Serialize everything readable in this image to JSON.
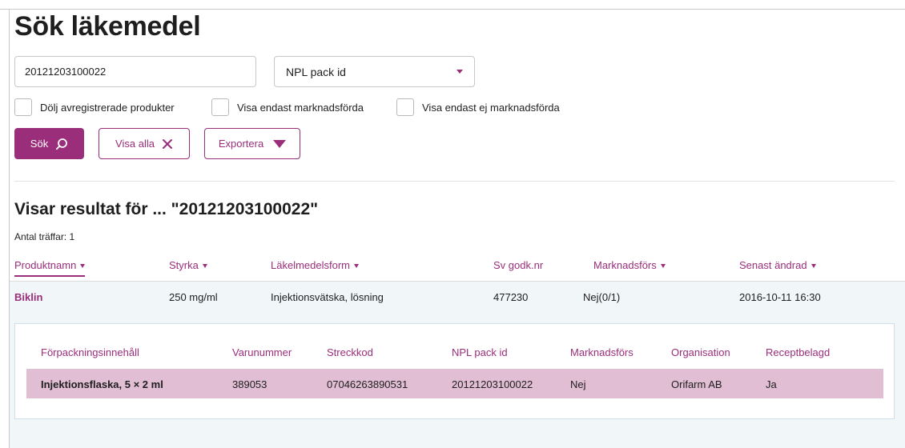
{
  "page": {
    "title": "Sök läkemedel"
  },
  "search": {
    "value": "20121203100022",
    "placeholder": "",
    "type_selected": "NPL pack id"
  },
  "filters": [
    {
      "label": "Dölj avregistrerade produkter",
      "checked": false
    },
    {
      "label": "Visa endast marknadsförda",
      "checked": false
    },
    {
      "label": "Visa endast ej marknadsförda",
      "checked": false
    }
  ],
  "buttons": {
    "search": "Sök",
    "show_all": "Visa alla",
    "export": "Exportera"
  },
  "results": {
    "heading": "Visar resultat för ... \"20121203100022\"",
    "count_label": "Antal träffar: 1",
    "columns": [
      "Produktnamn",
      "Styrka",
      "Läkelmedelsform",
      "Sv godk.nr",
      "Marknadsförs",
      "Senast ändrad"
    ],
    "rows": [
      {
        "name": "Biklin",
        "strength": "250 mg/ml",
        "form": "Injektionsvätska, lösning",
        "approval_no": "477230",
        "marketed": "Nej(0/1)",
        "last_modified": "2016-10-11 16:30"
      }
    ]
  },
  "packages": {
    "columns": [
      "Förpackningsinnehåll",
      "Varunummer",
      "Streckkod",
      "NPL pack id",
      "Marknadsförs",
      "Organisation",
      "Receptbelagd"
    ],
    "rows": [
      {
        "content": "Injektionsflaska, 5 × 2 ml",
        "item_no": "389053",
        "barcode": "07046263890531",
        "npl_pack_id": "20121203100022",
        "marketed": "Nej",
        "organisation": "Orifarm AB",
        "prescription": "Ja"
      }
    ]
  },
  "colors": {
    "accent": "#9a2e7b",
    "row_highlight": "#e1bed4",
    "result_bg": "#f1f6f9"
  }
}
